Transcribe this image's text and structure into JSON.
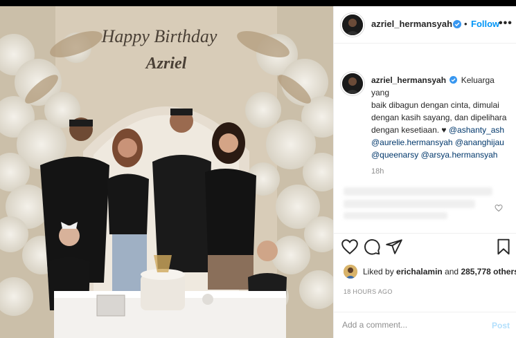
{
  "post": {
    "username": "azriel_hermansyah",
    "verified": true,
    "follow_label": "Follow",
    "separator": "•",
    "more_label": "•••",
    "photo_banner_line1": "Happy Birthday",
    "photo_banner_line2": "Azriel"
  },
  "caption": {
    "username": "azriel_hermansyah",
    "text_lines": [
      "Keluarga yang",
      "baik dibagun dengan cinta, dimulai",
      "dengan kasih sayang, dan dipelihara",
      "dengan kesetiaan. ♥ "
    ],
    "mentions": [
      "@ashanty_ash",
      "@aurelie.hermansyah",
      "@ananghijau",
      "@queenarsy",
      "@arsya.hermansyah"
    ],
    "time": "18h"
  },
  "actions": {
    "like_icon": "heart-icon",
    "comment_icon": "comment-icon",
    "share_icon": "paper-plane-icon",
    "save_icon": "bookmark-icon"
  },
  "likes": {
    "prefix": "Liked by ",
    "user": "erichalamin",
    "middle": " and ",
    "count": "285,778 others"
  },
  "timestamp": "18 HOURS AGO",
  "comment_box": {
    "placeholder": "Add a comment...",
    "post_label": "Post"
  },
  "colors": {
    "link": "#0095f6",
    "mention": "#00376b",
    "text": "#262626",
    "muted": "#8e8e8e"
  }
}
